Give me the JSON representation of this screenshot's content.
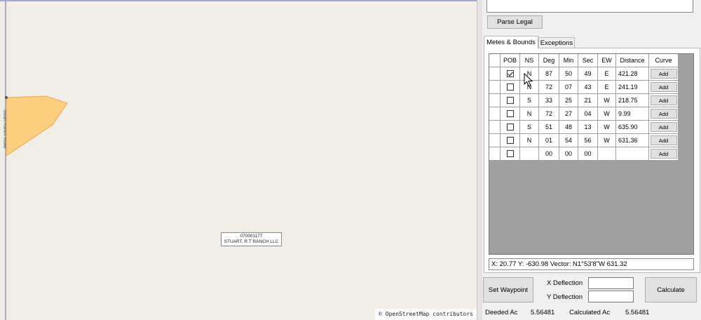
{
  "map": {
    "road_name": "Stuart Ranch Road",
    "parcel_label_line1": "070001177",
    "parcel_label_line2": "STUART, R T RANCH LLC",
    "attribution": "© OpenStreetMap contributors",
    "parcel_fill": "#fbcf7f",
    "parcel_stroke": "#e8a84c"
  },
  "panel": {
    "parse_button": "Parse Legal",
    "tabs": [
      {
        "label": "Metes & Bounds",
        "active": true
      },
      {
        "label": "Exceptions",
        "active": false
      }
    ],
    "columns": [
      "POB",
      "NS",
      "Deg",
      "Min",
      "Sec",
      "EW",
      "Distance",
      "Curve"
    ],
    "rows": [
      {
        "pob": true,
        "ns": "N",
        "deg": "87",
        "min": "50",
        "sec": "49",
        "ew": "E",
        "distance": "421.28",
        "curve": "Add"
      },
      {
        "pob": false,
        "ns": "N",
        "deg": "72",
        "min": "07",
        "sec": "43",
        "ew": "E",
        "distance": "241.19",
        "curve": "Add"
      },
      {
        "pob": false,
        "ns": "S",
        "deg": "33",
        "min": "25",
        "sec": "21",
        "ew": "W",
        "distance": "218.75",
        "curve": "Add"
      },
      {
        "pob": false,
        "ns": "N",
        "deg": "72",
        "min": "27",
        "sec": "04",
        "ew": "W",
        "distance": "9.99",
        "curve": "Add"
      },
      {
        "pob": false,
        "ns": "S",
        "deg": "51",
        "min": "48",
        "sec": "13",
        "ew": "W",
        "distance": "635.90",
        "curve": "Add"
      },
      {
        "pob": false,
        "ns": "N",
        "deg": "01",
        "min": "54",
        "sec": "56",
        "ew": "W",
        "distance": "631.36",
        "curve": "Add"
      },
      {
        "pob": false,
        "ns": "",
        "deg": "00",
        "min": "00",
        "sec": "00",
        "ew": "",
        "distance": "",
        "curve": "Add"
      }
    ],
    "status": "X: 20.77  Y: -630.98  Vector: N1°53'8\"W 631.32",
    "set_waypoint": "Set Waypoint",
    "x_deflection_label": "X Deflection",
    "y_deflection_label": "Y Deflection",
    "calculate": "Calculate",
    "deeded_label": "Deeded Ac",
    "deeded_value": "5.56481",
    "calculated_label": "Calculated Ac",
    "calculated_value": "5.56481"
  }
}
